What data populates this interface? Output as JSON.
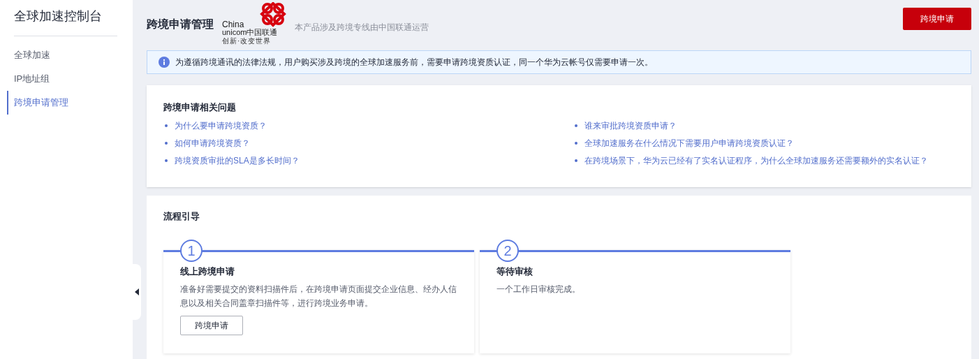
{
  "sidebar": {
    "title": "全球加速控制台",
    "items": [
      {
        "label": "全球加速",
        "selected": false
      },
      {
        "label": "IP地址组",
        "selected": false
      },
      {
        "label": "跨境申请管理",
        "selected": true
      }
    ]
  },
  "header": {
    "title": "跨境申请管理",
    "logo": {
      "line_1": "China",
      "line_2": "unicom中国联通",
      "line_3": "创新·改变世界"
    },
    "subtitle": "本产品涉及跨境专线由中国联通运营",
    "action": "跨境申请"
  },
  "notice": "为遵循跨境通讯的法律法规，用户购买涉及跨境的全球加速服务前，需要申请跨境资质认证，同一个华为云帐号仅需要申请一次。",
  "faq": {
    "title": "跨境申请相关问题",
    "questions": [
      "为什么要申请跨境资质？",
      "谁来审批跨境资质申请？",
      "如何申请跨境资质？",
      "全球加速服务在什么情况下需要用户申请跨境资质认证？",
      "跨境资质审批的SLA是多长时间？",
      "在跨境场景下，华为云已经有了实名认证程序，为什么全球加速服务还需要额外的实名认证？"
    ]
  },
  "process": {
    "title": "流程引导",
    "steps": [
      {
        "number": "1",
        "title": "线上跨境申请",
        "description": "准备好需要提交的资料扫描件后，在跨境申请页面提交企业信息、经办人信息以及相关合同盖章扫描件等，进行跨境业务申请。",
        "button": "跨境申请"
      },
      {
        "number": "2",
        "title": "等待审核",
        "description": "一个工作日审核完成。"
      }
    ]
  }
}
